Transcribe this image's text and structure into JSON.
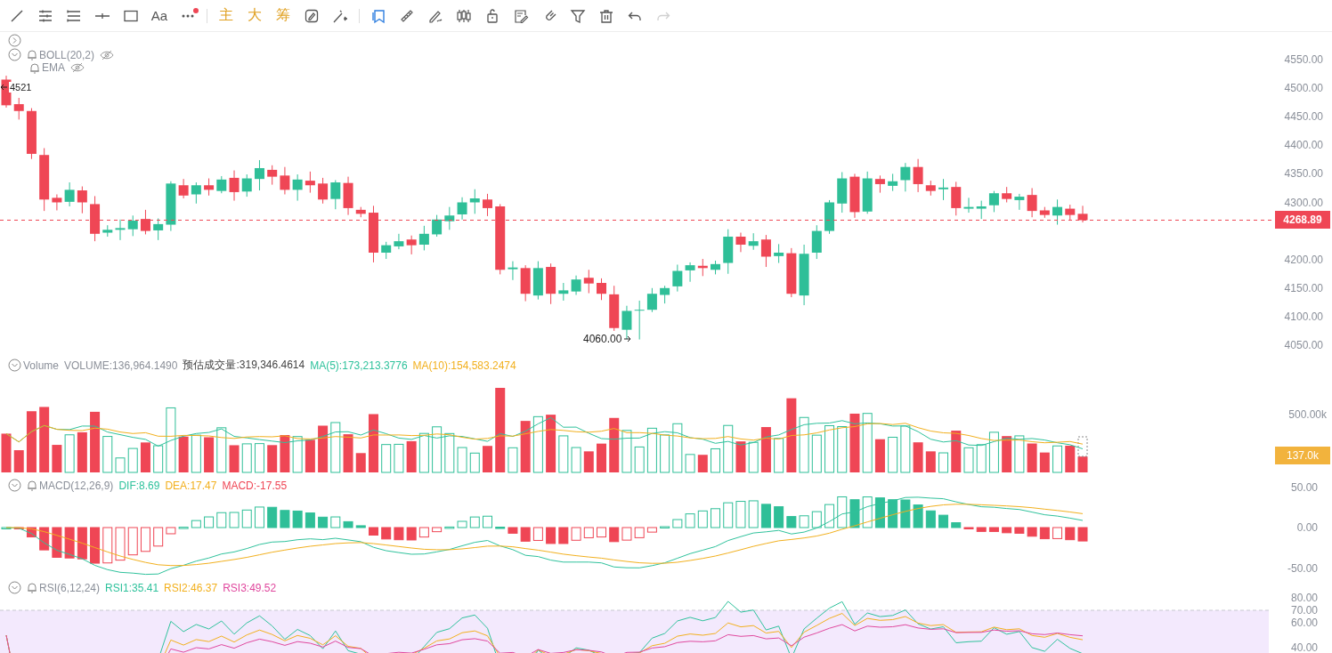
{
  "toolbar": {
    "text_tool": "Aa",
    "more_badge": true,
    "overlays": [
      {
        "label": "主"
      },
      {
        "label": "大"
      },
      {
        "label": "筹"
      }
    ],
    "bookmark_selected": true,
    "undo_disabled": false,
    "redo_disabled": true
  },
  "top_toggle": {
    "expanded": false
  },
  "main_indicators": [
    {
      "name": "BOLL(20,2)",
      "expanded": true,
      "visible": false
    },
    {
      "name": "EMA",
      "visible": false
    }
  ],
  "price_pane": {
    "high_label": "4521",
    "low_label": "4060.00",
    "last_price": "4268.89",
    "ticks": [
      "4550.00",
      "4500.00",
      "4450.00",
      "4400.00",
      "4350.00",
      "4300.00",
      "4200.00",
      "4150.00",
      "4100.00",
      "4050.00"
    ]
  },
  "volume": {
    "expanded": true,
    "title": "Volume",
    "values": [
      {
        "text": "VOLUME:136,964.1490",
        "color": "#8c9099"
      },
      {
        "text": "预估成交量:319,346.4614",
        "color": "#444444"
      },
      {
        "text": "MA(5):173,213.3776",
        "color": "#2fc29c"
      },
      {
        "text": "MA(10):154,583.2474",
        "color": "#f2b01e"
      }
    ],
    "tick": "500.00k",
    "last_tag": "137.0k"
  },
  "macd": {
    "expanded": true,
    "title": "MACD(12,26,9)",
    "values": [
      {
        "text": "DIF:8.69",
        "color": "#2fc29c"
      },
      {
        "text": "DEA:17.47",
        "color": "#f2b01e"
      },
      {
        "text": "MACD:-17.55",
        "color": "#ef4655"
      }
    ],
    "ticks": [
      "50.00",
      "0.00",
      "-50.00"
    ]
  },
  "rsi": {
    "expanded": true,
    "title": "RSI(6,12,24)",
    "values": [
      {
        "text": "RSI1:35.41",
        "color": "#2fc29c"
      },
      {
        "text": "RSI2:46.37",
        "color": "#f2b01e"
      },
      {
        "text": "RSI3:49.52",
        "color": "#e0489e"
      }
    ],
    "ticks": [
      "80.00",
      "70.00",
      "60.00",
      "40.00"
    ]
  }
}
